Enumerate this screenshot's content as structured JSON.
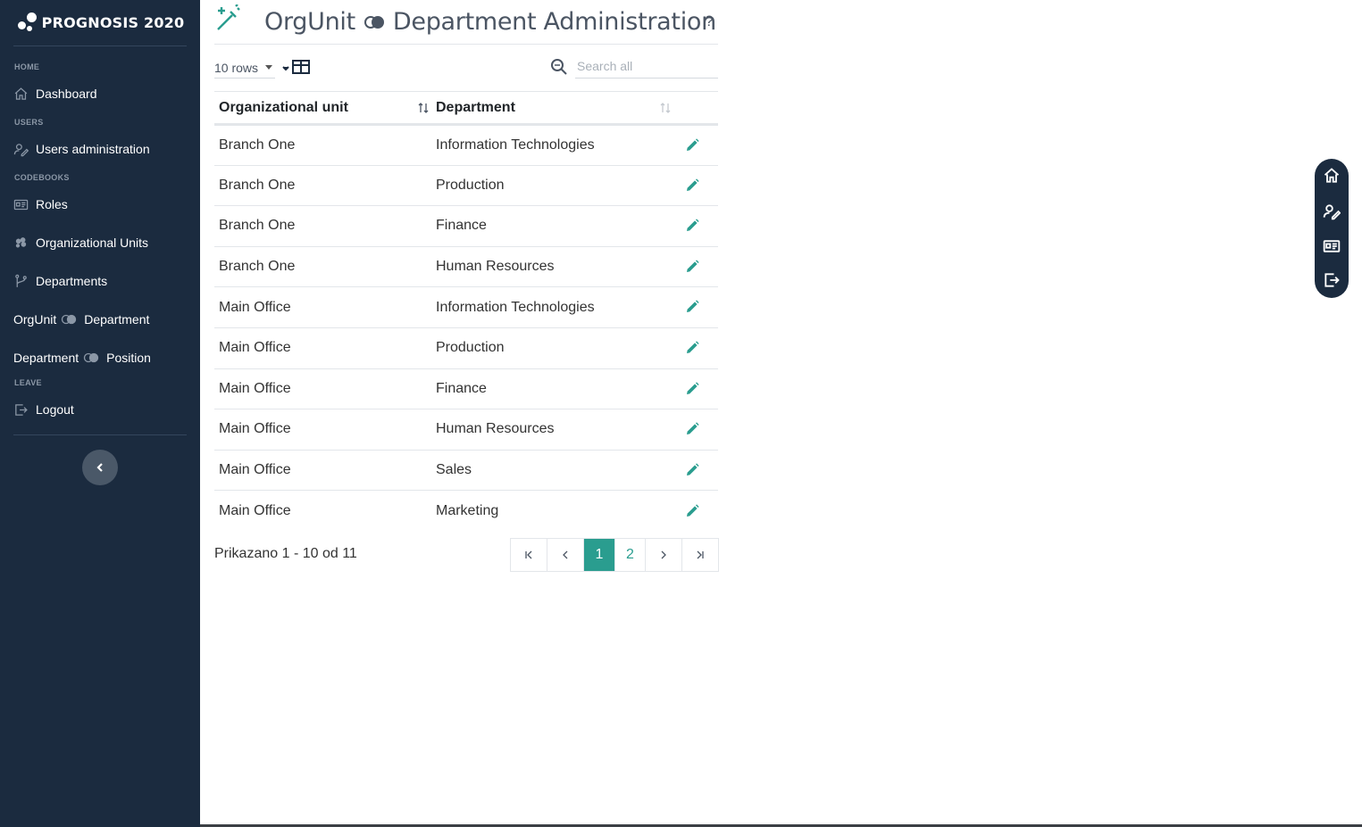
{
  "brand": {
    "name": "PROGNOSIS 2020"
  },
  "sidebar": {
    "sections": {
      "home": "HOME",
      "users": "USERS",
      "codebooks": "CODEBOOKS",
      "leave": "LEAVE"
    },
    "items": [
      {
        "label": "Dashboard",
        "icon": "home-icon"
      },
      {
        "label": "Users administration",
        "icon": "user-edit-icon"
      },
      {
        "label": "Roles",
        "icon": "id-card-icon"
      },
      {
        "label": "Organizational Units",
        "icon": "building-icon"
      },
      {
        "label": "Departments",
        "icon": "branch-icon"
      },
      {
        "label_left": "OrgUnit",
        "label_right": "Department",
        "icon": "link-circles-icon"
      },
      {
        "label_left": "Department",
        "label_right": "Position",
        "icon": "link-circles-icon"
      },
      {
        "label": "Logout",
        "icon": "logout-icon"
      }
    ]
  },
  "page": {
    "title_left": "OrgUnit",
    "title_right": "Department Administration",
    "help": "?"
  },
  "toolbar": {
    "rows_label": "10 rows",
    "search_placeholder": "Search all"
  },
  "table": {
    "columns": [
      "Organizational unit",
      "Department"
    ],
    "rows": [
      [
        "Branch One",
        "Information Technologies"
      ],
      [
        "Branch One",
        "Production"
      ],
      [
        "Branch One",
        "Finance"
      ],
      [
        "Branch One",
        "Human Resources"
      ],
      [
        "Main Office",
        "Information Technologies"
      ],
      [
        "Main Office",
        "Production"
      ],
      [
        "Main Office",
        "Finance"
      ],
      [
        "Main Office",
        "Human Resources"
      ],
      [
        "Main Office",
        "Sales"
      ],
      [
        "Main Office",
        "Marketing"
      ]
    ]
  },
  "pagination": {
    "summary": "Prikazano 1 - 10 od 11",
    "pages": [
      "1",
      "2"
    ],
    "current": "1"
  },
  "colors": {
    "sidebar_bg": "#1b2b3f",
    "accent": "#2a9d8f"
  }
}
